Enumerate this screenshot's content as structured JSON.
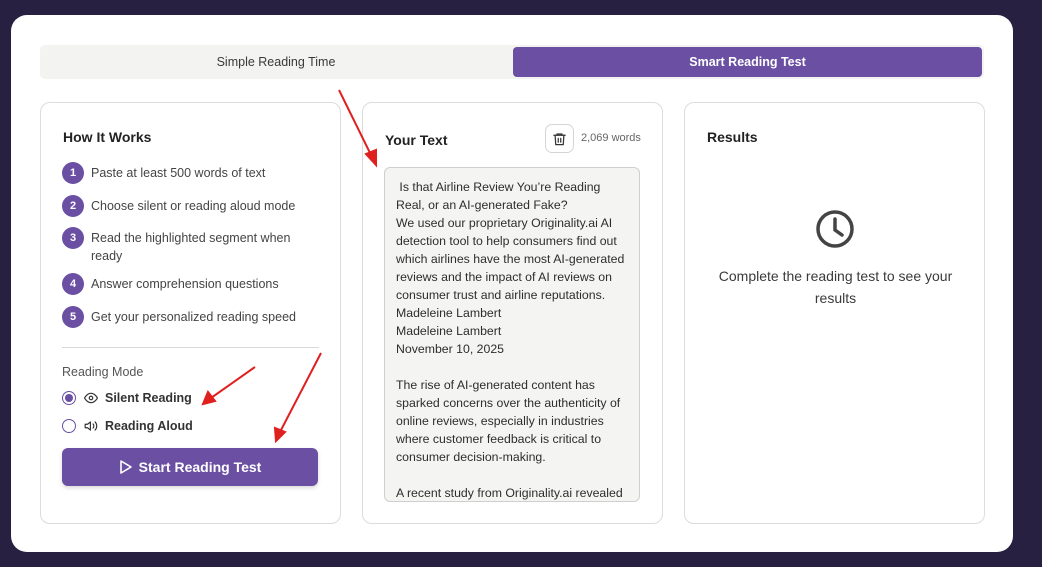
{
  "tabs": {
    "simple": "Simple Reading Time",
    "smart": "Smart Reading Test"
  },
  "how_it_works": {
    "title": "How It Works",
    "steps": [
      {
        "num": "1",
        "text": "Paste at least 500 words of text"
      },
      {
        "num": "2",
        "text": "Choose silent or reading aloud mode"
      },
      {
        "num": "3",
        "text": "Read the highlighted segment when ready"
      },
      {
        "num": "4",
        "text": "Answer comprehension questions"
      },
      {
        "num": "5",
        "text": "Get your personalized reading speed"
      }
    ],
    "mode_label": "Reading Mode",
    "modes": [
      {
        "label": "Silent Reading",
        "icon": "eye-icon",
        "selected": true
      },
      {
        "label": "Reading Aloud",
        "icon": "speaker-icon",
        "selected": false
      }
    ],
    "start_label": "Start Reading Test"
  },
  "your_text": {
    "title": "Your Text",
    "word_count": "2,069 words",
    "content": " Is that Airline Review You’re Reading Real, or an AI-generated Fake?\nWe used our proprietary Originality.ai AI detection tool to help consumers find out which airlines have the most AI-generated reviews and the impact of AI reviews on consumer trust and airline reputations.\nMadeleine Lambert\nMadeleine Lambert\nNovember 10, 2025\n\nThe rise of AI-generated content has sparked concerns over the authenticity of online reviews, especially in industries where customer feedback is critical to consumer decision-making.\n\nA recent study from Originality.ai revealed"
  },
  "results": {
    "title": "Results",
    "message": "Complete the reading test to see your results",
    "icon": "clock-icon"
  },
  "colors": {
    "accent": "#6a4fa3",
    "background": "#282040",
    "annotation_arrow": "#e0201e"
  }
}
